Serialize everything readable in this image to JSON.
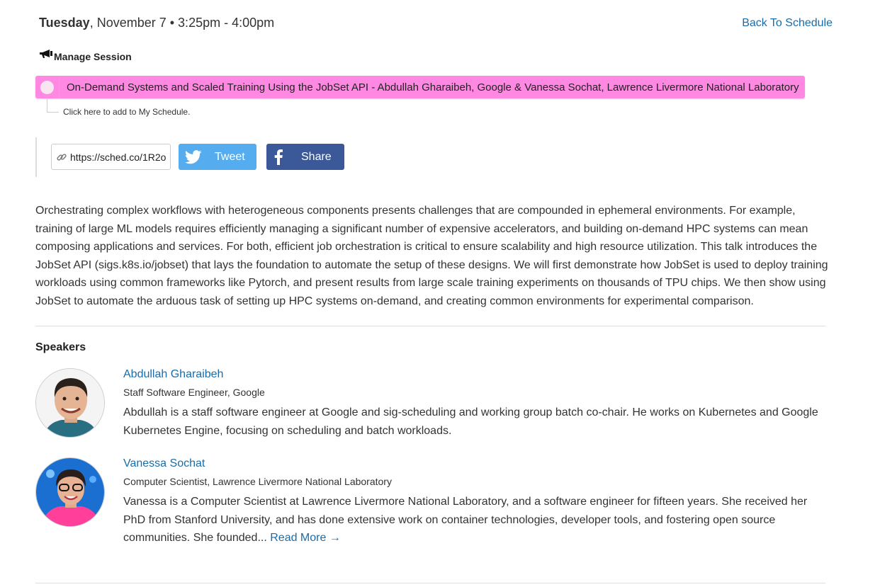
{
  "header": {
    "day": "Tuesday",
    "date_rest": ", November 7 • 3:25pm - 4:00pm",
    "back_link": "Back To Schedule"
  },
  "manage": {
    "label": "Manage Session"
  },
  "session": {
    "title": "On-Demand Systems and Scaled Training Using the JobSet API - Abdullah Gharaibeh, Google & Vanessa Sochat, Lawrence Livermore National Laboratory",
    "color": "#ff88e2",
    "add_hint": "Click here to add to My Schedule."
  },
  "share": {
    "url": "https://sched.co/1R2o",
    "tweet_label": "Tweet",
    "share_label": "Share",
    "tweet_color": "#55acee",
    "share_color": "#3b5998"
  },
  "description": "Orchestrating complex workflows with heterogeneous components presents challenges that are compounded in ephemeral environments. For example, training of large ML models requires efficiently managing a significant number of expensive accelerators, and building on-demand HPC systems can mean composing applications and services. For both, efficient job orchestration is critical to ensure scalability and high resource utilization. This talk introduces the JobSet API (sigs.k8s.io/jobset) that lays the foundation to automate the setup of these designs. We will first demonstrate how JobSet is used to deploy training workloads using common frameworks like Pytorch, and present results from large scale training experiments on thousands of TPU chips. We then show using JobSet to automate the arduous task of setting up HPC systems on-demand, and creating common environments for experimental comparison.",
  "speakers": {
    "heading": "Speakers",
    "items": [
      {
        "name": "Abdullah Gharaibeh",
        "role": "Staff Software Engineer, Google",
        "bio": "Abdullah is a staff software engineer at Google and sig-scheduling and working group batch co-chair. He works on Kubernetes and Google Kubernetes Engine, focusing on scheduling and batch workloads."
      },
      {
        "name": "Vanessa Sochat",
        "role": "Computer Scientist, Lawrence Livermore National Laboratory",
        "bio": "Vanessa is a Computer Scientist at Lawrence Livermore National Laboratory, and a software engineer for fifteen years. She received her PhD from Stanford University, and has done extensive work on container technologies, developer tools, and fostering open source communities. She founded...",
        "read_more": "Read More →"
      }
    ]
  },
  "colors": {
    "link": "#1a6ca8",
    "text": "#333333"
  }
}
